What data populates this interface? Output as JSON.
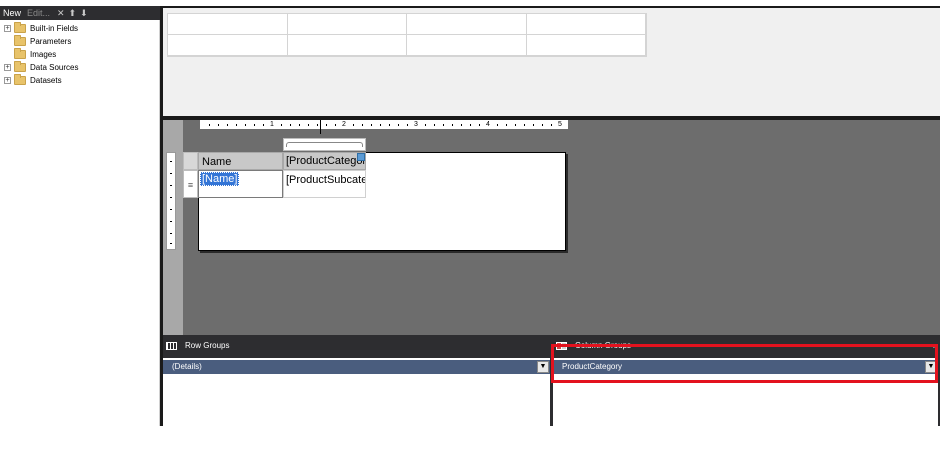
{
  "left_toolbar": {
    "new_label": "New",
    "edit_label": "Edit...",
    "delete_icon": "close-icon",
    "up_icon": "arrow-up-icon",
    "down_icon": "arrow-down-icon"
  },
  "report_data_tree": {
    "items": [
      {
        "label": "Built-in Fields",
        "expandable": true
      },
      {
        "label": "Parameters",
        "expandable": false
      },
      {
        "label": "Images",
        "expandable": false
      },
      {
        "label": "Data Sources",
        "expandable": true
      },
      {
        "label": "Datasets",
        "expandable": true
      }
    ]
  },
  "ruler": {
    "numbers": [
      "1",
      "2",
      "3",
      "4",
      "5"
    ]
  },
  "tablix": {
    "header_name": "Name",
    "header_product_category": "[ProductCategory]",
    "detail_name": "[Name]",
    "detail_product_subcategory": "[ProductSubcategory]",
    "row_handle_glyph": "≡"
  },
  "grouping": {
    "row_groups_title": "Row Groups",
    "column_groups_title": "Column Groups",
    "row_group_item": "(Details)",
    "column_group_item": "ProductCategory",
    "dropdown_glyph": "▼",
    "highlight_color": "#e3121e"
  },
  "colors": {
    "dark_chrome": "#2d2d30",
    "design_surface": "#6d6d6d",
    "group_item_bg": "#4a5d7e",
    "selection": "#3375d6"
  }
}
